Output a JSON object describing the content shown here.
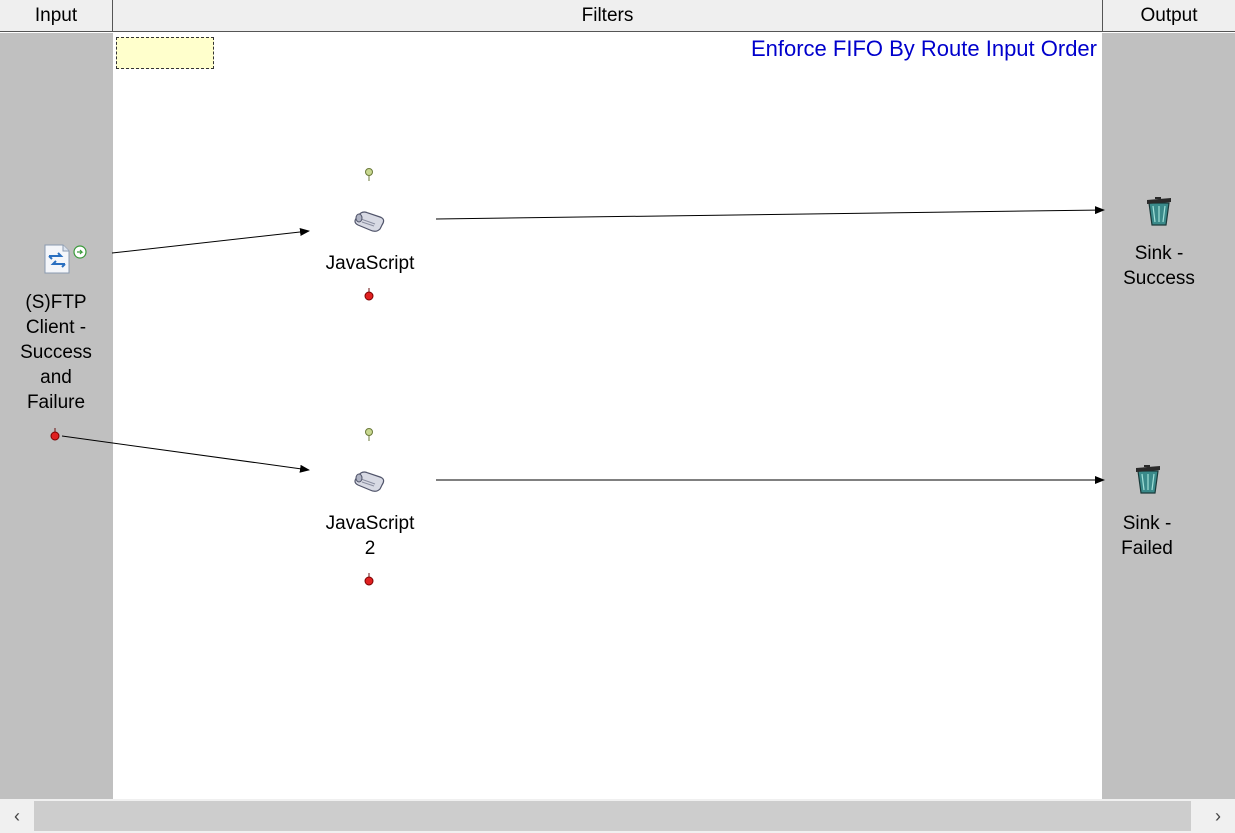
{
  "columns": {
    "input": "Input",
    "filters": "Filters",
    "output": "Output"
  },
  "route_title": "Enforce FIFO By Route Input Order",
  "input_node": {
    "label_lines": [
      "(S)FTP",
      "Client -",
      "Success",
      "and",
      "Failure"
    ],
    "icon": "ftp-client-icon"
  },
  "filters": [
    {
      "label_lines": [
        "JavaScript"
      ],
      "icon": "script-scroll-icon"
    },
    {
      "label_lines": [
        "JavaScript",
        "2"
      ],
      "icon": "script-scroll-icon"
    }
  ],
  "outputs": [
    {
      "label_lines": [
        "Sink -",
        "Success"
      ],
      "icon": "trash-bin-icon"
    },
    {
      "label_lines": [
        "Sink -",
        "Failed"
      ],
      "icon": "trash-bin-icon"
    }
  ],
  "colors": {
    "title": "#0000cc",
    "column_bg": "#c0c0c0",
    "note_bg": "#ffffcc",
    "success_port": "#a8c060",
    "failure_port": "#e02020"
  },
  "scrollbar": {
    "left_arrow": "‹",
    "right_arrow": "›"
  }
}
